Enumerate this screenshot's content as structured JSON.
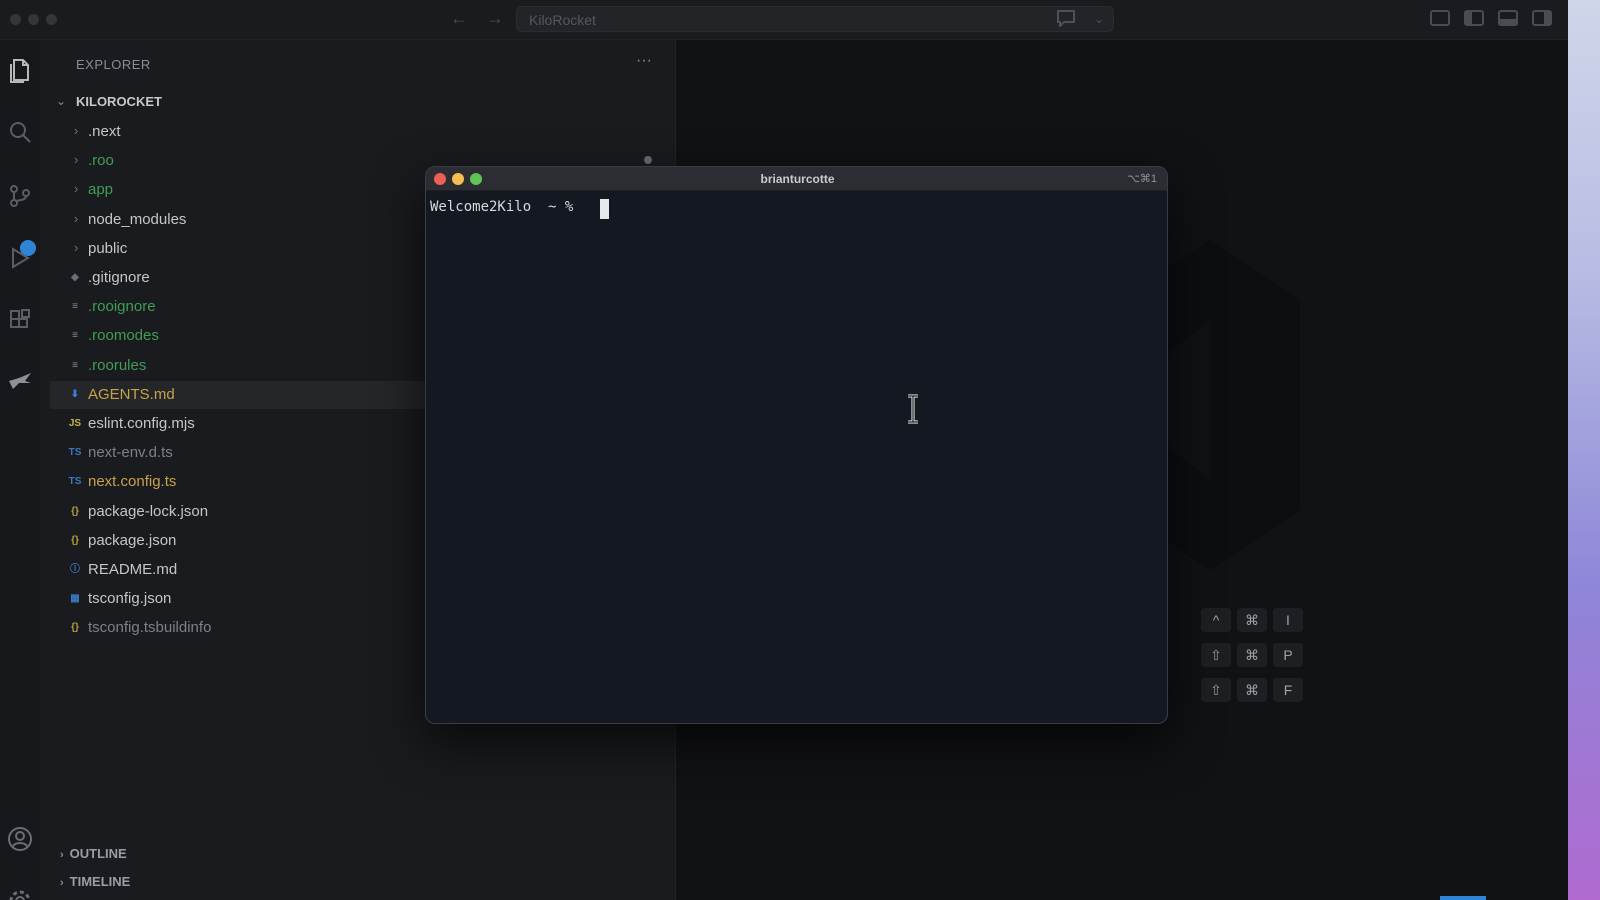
{
  "titlebar": {
    "search_text": "KiloRocket",
    "back_icon": "arrow-left-icon",
    "forward_icon": "arrow-right-icon"
  },
  "activity_bar": {
    "icons": [
      "files-icon",
      "search-icon",
      "source-control-icon",
      "run-debug-icon",
      "extensions-icon",
      "kilo-icon",
      "account-icon",
      "settings-icon"
    ]
  },
  "explorer": {
    "title": "EXPLORER",
    "more": "···",
    "root": "KILOROCKET",
    "items": [
      {
        "label": ".next",
        "kind": "folder",
        "color": "default"
      },
      {
        "label": ".roo",
        "kind": "folder",
        "color": "green"
      },
      {
        "label": "app",
        "kind": "folder",
        "color": "green"
      },
      {
        "label": "node_modules",
        "kind": "folder",
        "color": "default"
      },
      {
        "label": "public",
        "kind": "folder",
        "color": "default"
      },
      {
        "label": ".gitignore",
        "kind": "file",
        "icon": "◆",
        "color": "default"
      },
      {
        "label": ".rooignore",
        "kind": "file",
        "icon": "≡",
        "color": "green"
      },
      {
        "label": ".roomodes",
        "kind": "file",
        "icon": "≡",
        "color": "green"
      },
      {
        "label": ".roorules",
        "kind": "file",
        "icon": "≡",
        "color": "green"
      },
      {
        "label": "AGENTS.md",
        "kind": "file",
        "icon": "⬇",
        "color": "yellow",
        "selected": true
      },
      {
        "label": "eslint.config.mjs",
        "kind": "file",
        "icon": "JS",
        "color": "default"
      },
      {
        "label": "next-env.d.ts",
        "kind": "file",
        "icon": "TS",
        "color": "muted"
      },
      {
        "label": "next.config.ts",
        "kind": "file",
        "icon": "TS",
        "color": "yellow"
      },
      {
        "label": "package-lock.json",
        "kind": "file",
        "icon": "{}",
        "color": "default"
      },
      {
        "label": "package.json",
        "kind": "file",
        "icon": "{}",
        "color": "default"
      },
      {
        "label": "README.md",
        "kind": "file",
        "icon": "ⓘ",
        "color": "default"
      },
      {
        "label": "tsconfig.json",
        "kind": "file",
        "icon": "▦",
        "color": "default"
      },
      {
        "label": "tsconfig.tsbuildinfo",
        "kind": "file",
        "icon": "{}",
        "color": "muted"
      }
    ],
    "sections": [
      "OUTLINE",
      "TIMELINE"
    ]
  },
  "terminal": {
    "title": "brianturcotte",
    "shortcut": "⌥⌘1",
    "prompt": "Welcome2Kilo  ~ %"
  },
  "shortcuts": [
    [
      "^",
      "⌘",
      "I"
    ],
    [
      "⇧",
      "⌘",
      "P"
    ],
    [
      "⇧",
      "⌘",
      "F"
    ]
  ],
  "colors": {
    "accent": "#2f84d6",
    "git_added": "#3f9d55",
    "git_modified": "#c9a246",
    "close": "#ed5f57",
    "minimize": "#f5be4f",
    "zoom": "#5fc454"
  }
}
